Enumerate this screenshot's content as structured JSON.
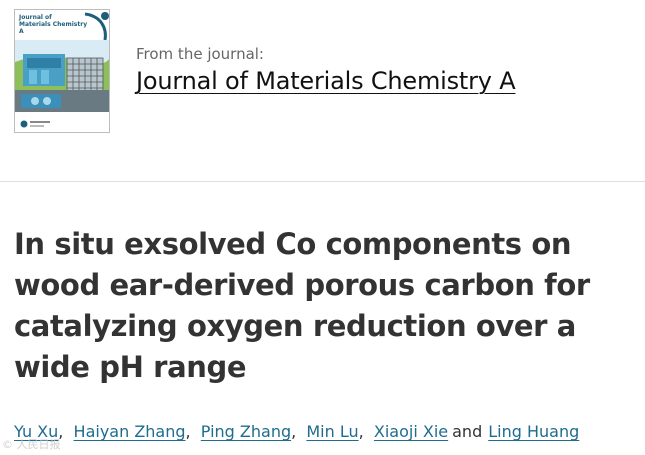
{
  "journal": {
    "from_label": "From the journal:",
    "name": "Journal of Materials Chemistry A",
    "cover_title_line1": "Journal of",
    "cover_title_line2": "Materials Chemistry A"
  },
  "article": {
    "title": "In situ exsolved Co components on wood ear-derived porous carbon for catalyzing oxygen reduction over a wide pH range",
    "authors": [
      "Yu Xu",
      "Haiyan Zhang",
      "Ping Zhang",
      "Min Lu",
      "Xiaoji Xie",
      "Ling Huang"
    ],
    "separator": ",",
    "conjunction": "and"
  },
  "watermark": {
    "text": "© 人民日报"
  },
  "colors": {
    "link": "#1e6c8f",
    "title_text": "#333333",
    "journal_text": "#111111",
    "divider": "#dddddd",
    "cover_accent": "#1b5f7a"
  }
}
